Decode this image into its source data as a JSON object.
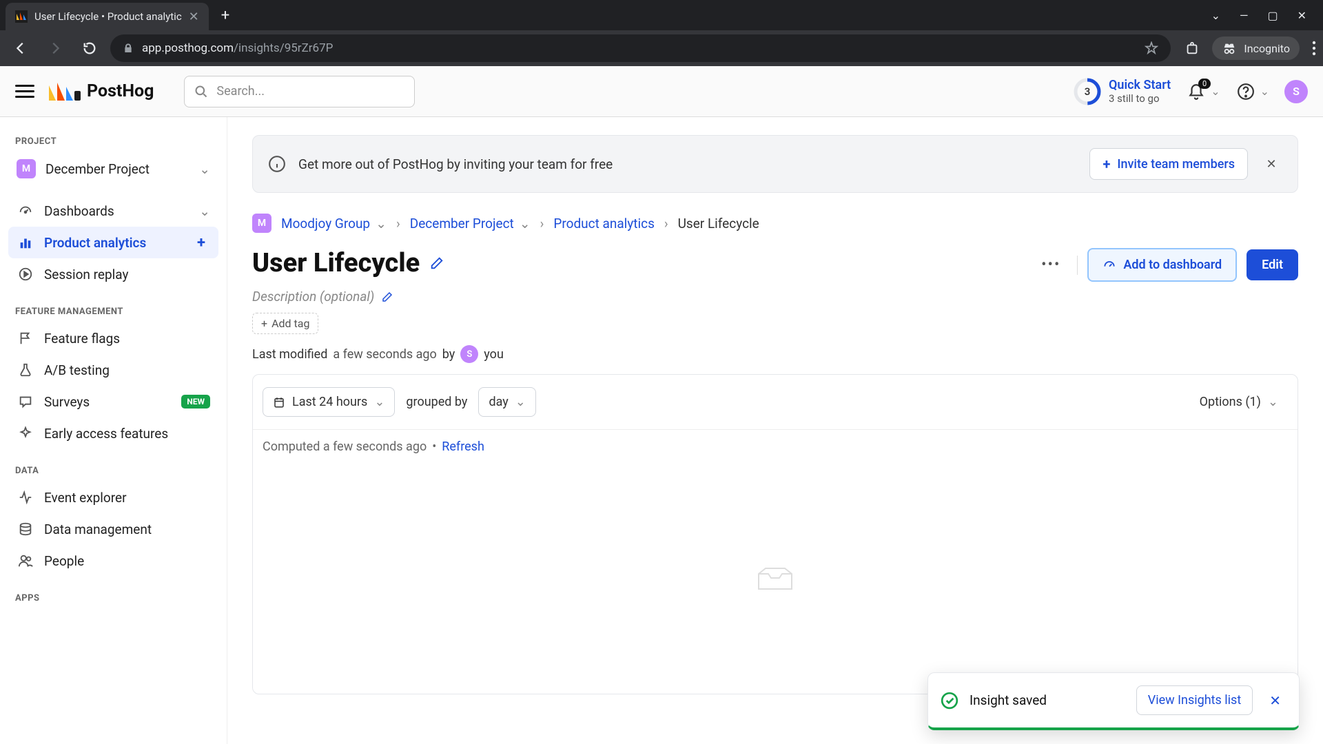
{
  "browser": {
    "tab_title": "User Lifecycle • Product analytic",
    "url_host": "app.posthog.com",
    "url_path": "/insights/95rZr67P",
    "incognito_label": "Incognito"
  },
  "header": {
    "brand": "PostHog",
    "search_placeholder": "Search...",
    "quick_start_title": "Quick Start",
    "quick_start_sub": "3 still to go",
    "quick_start_count": "3",
    "notif_count": "0",
    "avatar_letter": "S"
  },
  "sidebar": {
    "section_project": "PROJECT",
    "project_badge": "M",
    "project_name": "December Project",
    "item_dashboards": "Dashboards",
    "item_product_analytics": "Product analytics",
    "item_session_replay": "Session replay",
    "section_feature": "FEATURE MANAGEMENT",
    "item_feature_flags": "Feature flags",
    "item_ab_testing": "A/B testing",
    "item_surveys": "Surveys",
    "item_surveys_badge": "NEW",
    "item_early_access": "Early access features",
    "section_data": "DATA",
    "item_event_explorer": "Event explorer",
    "item_data_mgmt": "Data management",
    "item_people": "People",
    "section_apps": "APPS"
  },
  "banner": {
    "message": "Get more out of PostHog by inviting your team for free",
    "invite_label": "Invite team members"
  },
  "breadcrumb": {
    "org_badge": "M",
    "org": "Moodjoy Group",
    "project": "December Project",
    "section": "Product analytics",
    "current": "User Lifecycle"
  },
  "page": {
    "title": "User Lifecycle",
    "description_placeholder": "Description (optional)",
    "add_tag_label": "Add tag",
    "modified_prefix": "Last modified",
    "modified_time": "a few seconds ago",
    "modified_by": "by",
    "modified_user_letter": "S",
    "modified_user": "you",
    "add_dashboard": "Add to dashboard",
    "edit": "Edit"
  },
  "chart": {
    "date_range": "Last 24 hours",
    "group_label": "grouped by",
    "group_value": "day",
    "options_label": "Options (1)",
    "computed_text": "Computed a few seconds ago",
    "refresh": "Refresh"
  },
  "toast": {
    "message": "Insight saved",
    "action": "View Insights list"
  }
}
